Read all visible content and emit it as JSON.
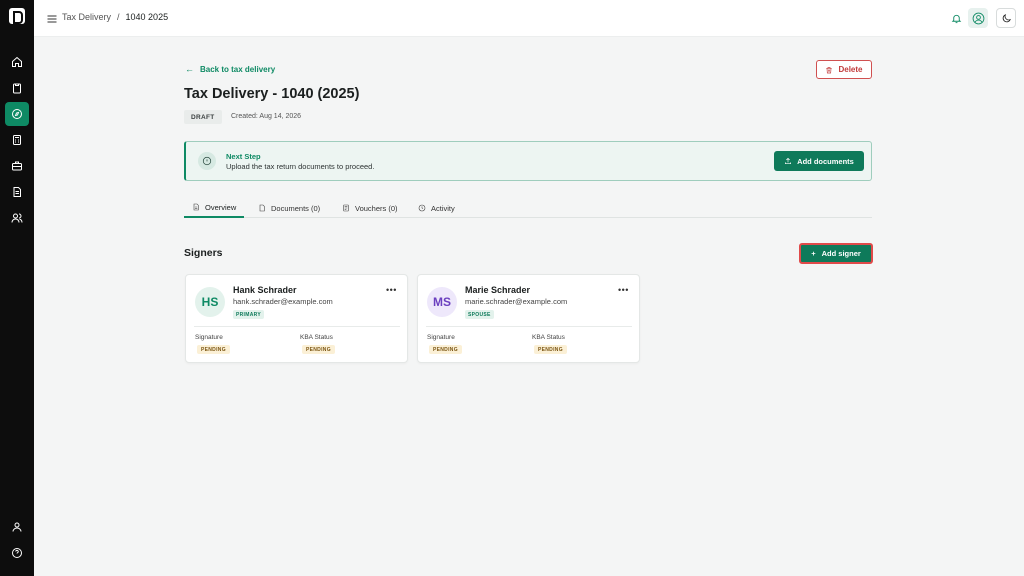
{
  "breadcrumb": {
    "parent": "Tax Delivery",
    "separator": "/",
    "current": "1040 2025"
  },
  "sidebar": {
    "items": [
      {
        "icon": "home-icon"
      },
      {
        "icon": "clipboard-icon"
      },
      {
        "icon": "compass-icon",
        "active": true
      },
      {
        "icon": "calculator-icon"
      },
      {
        "icon": "briefcase-icon"
      },
      {
        "icon": "file-text-icon"
      },
      {
        "icon": "users-icon"
      }
    ],
    "bottom": [
      {
        "icon": "user-icon"
      },
      {
        "icon": "help-icon"
      }
    ]
  },
  "page": {
    "back_label": "Back to tax delivery",
    "delete_label": "Delete",
    "title": "Tax Delivery - 1040 (2025)",
    "status_badge": "DRAFT",
    "created": "Created: Aug 14, 2026"
  },
  "next_step": {
    "heading": "Next Step",
    "text": "Upload the tax return documents to proceed.",
    "button": "Add documents"
  },
  "tabs": [
    {
      "label": "Overview",
      "active": true
    },
    {
      "label": "Documents (0)"
    },
    {
      "label": "Vouchers (0)"
    },
    {
      "label": "Activity"
    }
  ],
  "signers": {
    "heading": "Signers",
    "add_label": "Add signer",
    "list": [
      {
        "initials": "HS",
        "name": "Hank Schrader",
        "email": "hank.schrader@example.com",
        "role": "PRIMARY",
        "signature_label": "Signature",
        "signature_status": "PENDING",
        "kba_label": "KBA Status",
        "kba_status": "PENDING"
      },
      {
        "initials": "MS",
        "name": "Marie Schrader",
        "email": "marie.schrader@example.com",
        "role": "SPOUSE",
        "signature_label": "Signature",
        "signature_status": "PENDING",
        "kba_label": "KBA Status",
        "kba_status": "PENDING"
      }
    ]
  },
  "colors": {
    "accent": "#0e8a64",
    "primary_button": "#0e7a5a",
    "danger": "#c23b3b",
    "pending_bg": "#fbf0d6",
    "rail_bg": "#0d0d0d"
  }
}
